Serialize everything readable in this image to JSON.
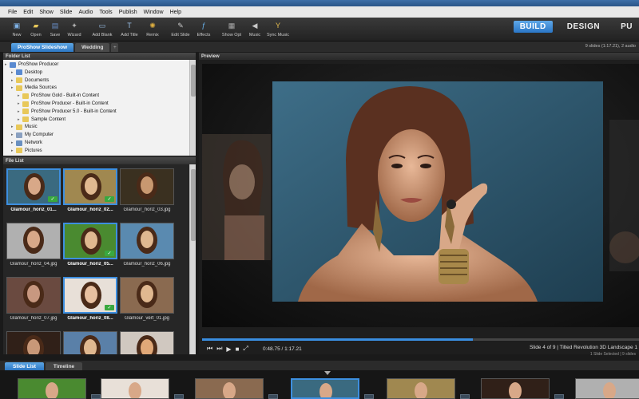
{
  "menu": [
    "File",
    "Edit",
    "Show",
    "Slide",
    "Audio",
    "Tools",
    "Publish",
    "Window",
    "Help"
  ],
  "toolbar": [
    {
      "label": "New",
      "icon": "new-show-icon",
      "color": "#7fb2e6"
    },
    {
      "label": "Open",
      "icon": "open-folder-icon",
      "color": "#e8c85a"
    },
    {
      "label": "Save",
      "icon": "save-disk-icon",
      "color": "#6a8fc8"
    },
    {
      "label": "Wizard",
      "icon": "wizard-icon",
      "color": "#b0b0b0"
    },
    {
      "label": "Add Blank",
      "icon": "add-blank-icon",
      "color": "#9ac0e8"
    },
    {
      "label": "Add Title",
      "icon": "add-title-icon",
      "color": "#9ac0e8"
    },
    {
      "label": "Remix",
      "icon": "remix-icon",
      "color": "#e0b040"
    },
    {
      "label": "Edit Slide",
      "icon": "edit-slide-icon",
      "color": "#c8c8c8"
    },
    {
      "label": "Effects",
      "icon": "effects-fx-icon",
      "color": "#6ab4f0"
    },
    {
      "label": "Show Opt",
      "icon": "show-options-icon",
      "color": "#a8a8a8"
    },
    {
      "label": "Music",
      "icon": "music-speaker-icon",
      "color": "#c8c8c8"
    },
    {
      "label": "Sync Music",
      "icon": "sync-music-icon",
      "color": "#e8c050"
    }
  ],
  "modes": [
    "BUILD",
    "DESIGN",
    "PU"
  ],
  "show_tabs": [
    "ProShow Slideshow",
    "Wedding"
  ],
  "show_info": "9 slides (1:17.21), 2 audio",
  "folder_panel": {
    "title": "Folder List",
    "items": [
      {
        "label": "ProShow Producer",
        "depth": 0,
        "color": "#5a8ad0"
      },
      {
        "label": "Desktop",
        "depth": 1,
        "color": "#5a8ad0"
      },
      {
        "label": "Documents",
        "depth": 1,
        "color": "#e8c85a"
      },
      {
        "label": "Media Sources",
        "depth": 1,
        "color": "#e8c85a"
      },
      {
        "label": "ProShow Gold - Built-in Content",
        "depth": 2,
        "color": "#e8c85a"
      },
      {
        "label": "ProShow Producer - Built-in Content",
        "depth": 2,
        "color": "#e8c85a"
      },
      {
        "label": "ProShow Producer 5.0 - Built-in Content",
        "depth": 2,
        "color": "#e8c85a"
      },
      {
        "label": "Sample Content",
        "depth": 2,
        "color": "#e8c85a"
      },
      {
        "label": "Music",
        "depth": 1,
        "color": "#e8c85a"
      },
      {
        "label": "My Computer",
        "depth": 1,
        "color": "#8aa0c0"
      },
      {
        "label": "Network",
        "depth": 1,
        "color": "#6a90c0"
      },
      {
        "label": "Pictures",
        "depth": 1,
        "color": "#e8c85a"
      }
    ]
  },
  "file_panel": {
    "title": "File List",
    "files": [
      {
        "name": "Glamour_horiz_01...",
        "selected": true,
        "checked": true,
        "bg": "#3a6a80",
        "skin": "#d8a888"
      },
      {
        "name": "Glamour_horiz_02...",
        "selected": true,
        "checked": true,
        "bg": "#a08850",
        "skin": "#e0b890"
      },
      {
        "name": "Glamour_horiz_03.jpg",
        "selected": false,
        "checked": false,
        "bg": "#3a3020",
        "skin": "#c89870"
      },
      {
        "name": "Glamour_horiz_04.jpg",
        "selected": false,
        "checked": false,
        "bg": "#b0b0b0",
        "skin": "#d8a888"
      },
      {
        "name": "Glamour_horiz_05...",
        "selected": true,
        "checked": true,
        "bg": "#4a8a30",
        "skin": "#e0b890"
      },
      {
        "name": "Glamour_horiz_06.jpg",
        "selected": false,
        "checked": false,
        "bg": "#5a8ab0",
        "skin": "#e0b890"
      },
      {
        "name": "Glamour_horiz_07.jpg",
        "selected": false,
        "checked": false,
        "bg": "#6a4a40",
        "skin": "#c89880"
      },
      {
        "name": "Glamour_horiz_08...",
        "selected": true,
        "checked": true,
        "bg": "#e8e0d8",
        "skin": "#e8c0a0"
      },
      {
        "name": "Glamour_vert_01.jpg",
        "selected": false,
        "checked": false,
        "bg": "#8a6a50",
        "skin": "#e0b890"
      },
      {
        "name": "",
        "selected": false,
        "checked": false,
        "bg": "#302018",
        "skin": "#c89878"
      },
      {
        "name": "",
        "selected": false,
        "checked": false,
        "bg": "#5a80a8",
        "skin": "#e0b890"
      },
      {
        "name": "",
        "selected": false,
        "checked": false,
        "bg": "#d0c8c0",
        "skin": "#e0a878"
      }
    ]
  },
  "preview": {
    "title": "Preview",
    "time": "0:48.75 / 1:17.21",
    "progress": 0.62,
    "slide_info": "Slide 4 of 9  |  Tilted Revolution 3D Landscape 1",
    "selected_info": "1 Slide Selected  |  9 slides",
    "colors": {
      "backdrop": "#3e6e88",
      "skin": "#d8a080",
      "hair": "#5a3020"
    }
  },
  "bottom_tabs": [
    "Slide List",
    "Timeline"
  ],
  "timeline_slides": [
    {
      "bg": "#4a8a30",
      "selected": false
    },
    {
      "bg": "#e8e0d8",
      "selected": false
    },
    {
      "bg": "#8a6a50",
      "selected": false
    },
    {
      "bg": "#3a6a80",
      "selected": true
    },
    {
      "bg": "#a08850",
      "selected": false
    },
    {
      "bg": "#302018",
      "selected": false
    },
    {
      "bg": "#b0b0b0",
      "selected": false
    }
  ]
}
